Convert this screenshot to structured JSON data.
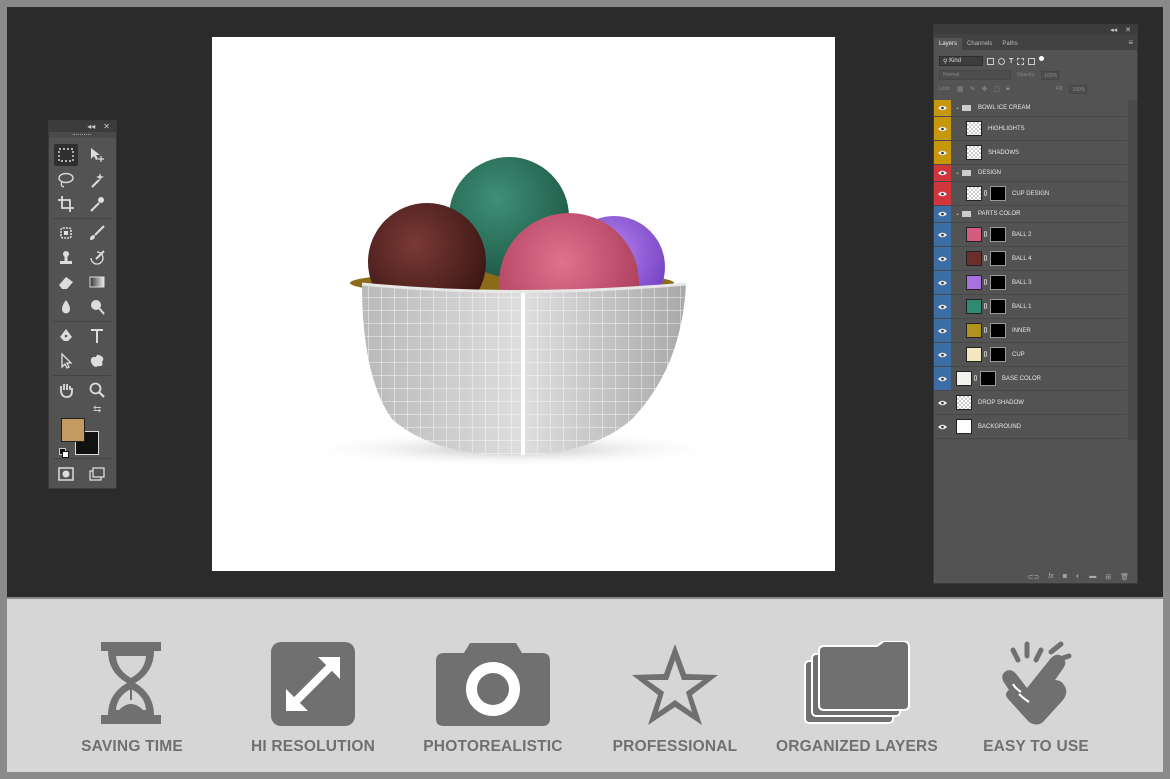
{
  "toolbox": {
    "collapse_glyph": "◂◂",
    "close_glyph": "✕",
    "fg_color": "#c49a63",
    "bg_color": "#111111"
  },
  "layers_panel": {
    "top_glyphs": [
      "◂◂",
      "✕"
    ],
    "tabs": [
      "Layers",
      "Channels",
      "Paths"
    ],
    "active_tab": "Layers",
    "filter_kind": "Kind",
    "blend_mode": "Normal",
    "opacity_label": "Opacity:",
    "opacity_value": "100%",
    "lock_label": "Lock:",
    "fill_label": "Fill:",
    "fill_value": "100%",
    "layers": [
      {
        "name": "BOWL ICE CREAM",
        "kind": "group",
        "eye_color": "#c8960a",
        "thumb": "",
        "mask": false
      },
      {
        "name": "HIGHLIGHTS",
        "kind": "layer",
        "eye_color": "#c8960a",
        "thumb": "checker",
        "mask": false
      },
      {
        "name": "SHADOWS",
        "kind": "layer",
        "eye_color": "#c8960a",
        "thumb": "checker",
        "mask": false
      },
      {
        "name": "DESIGN",
        "kind": "group",
        "eye_color": "#d0363b",
        "thumb": "",
        "mask": false
      },
      {
        "name": "CUP DESIGN",
        "kind": "layer",
        "eye_color": "#d0363b",
        "thumb": "checker",
        "mask": true
      },
      {
        "name": "PARTS COLOR",
        "kind": "group",
        "eye_color": "#3a6ea5",
        "thumb": "",
        "mask": false
      },
      {
        "name": "BALL 2",
        "kind": "layer",
        "eye_color": "#3a6ea5",
        "thumb": "#d35d7e",
        "mask": true
      },
      {
        "name": "BALL 4",
        "kind": "layer",
        "eye_color": "#3a6ea5",
        "thumb": "#6b2e2a",
        "mask": true
      },
      {
        "name": "BALL 3",
        "kind": "layer",
        "eye_color": "#3a6ea5",
        "thumb": "#a970e0",
        "mask": true
      },
      {
        "name": "BALL 1",
        "kind": "layer",
        "eye_color": "#3a6ea5",
        "thumb": "#2f8a73",
        "mask": true
      },
      {
        "name": "INNER",
        "kind": "layer",
        "eye_color": "#3a6ea5",
        "thumb": "#b0931c",
        "mask": true
      },
      {
        "name": "CUP",
        "kind": "layer",
        "eye_color": "#3a6ea5",
        "thumb": "#f5e7c1",
        "mask": true
      },
      {
        "name": "BASE COLOR",
        "kind": "base",
        "eye_color": "#3a6ea5",
        "thumb": "#f3f1ee",
        "mask": true
      },
      {
        "name": "DROP SHADOW",
        "kind": "plain",
        "eye_color": "#535353",
        "thumb": "checker",
        "mask": false
      },
      {
        "name": "BACKGROUND",
        "kind": "plain",
        "eye_color": "#535353",
        "thumb": "#ffffff",
        "mask": false
      }
    ],
    "bottom_icons": [
      "link-icon",
      "fx-icon",
      "add-mask-icon",
      "adjustment-icon",
      "folder-icon",
      "new-layer-icon",
      "trash-icon"
    ],
    "fx_text": "fx"
  },
  "features": [
    {
      "label": "SAVING TIME",
      "icon": "hourglass-icon"
    },
    {
      "label": "HI RESOLUTION",
      "icon": "expand-icon"
    },
    {
      "label": "PHOTOREALISTIC",
      "icon": "camera-icon"
    },
    {
      "label": "PROFESSIONAL",
      "icon": "star-icon"
    },
    {
      "label": "ORGANIZED LAYERS",
      "icon": "folders-icon"
    },
    {
      "label": "EASY TO USE",
      "icon": "hand-click-icon"
    }
  ],
  "colors": {
    "workspace": "#2b2b2b",
    "panel": "#535353",
    "feature_text": "#707070",
    "feature_icon": "#707070"
  }
}
